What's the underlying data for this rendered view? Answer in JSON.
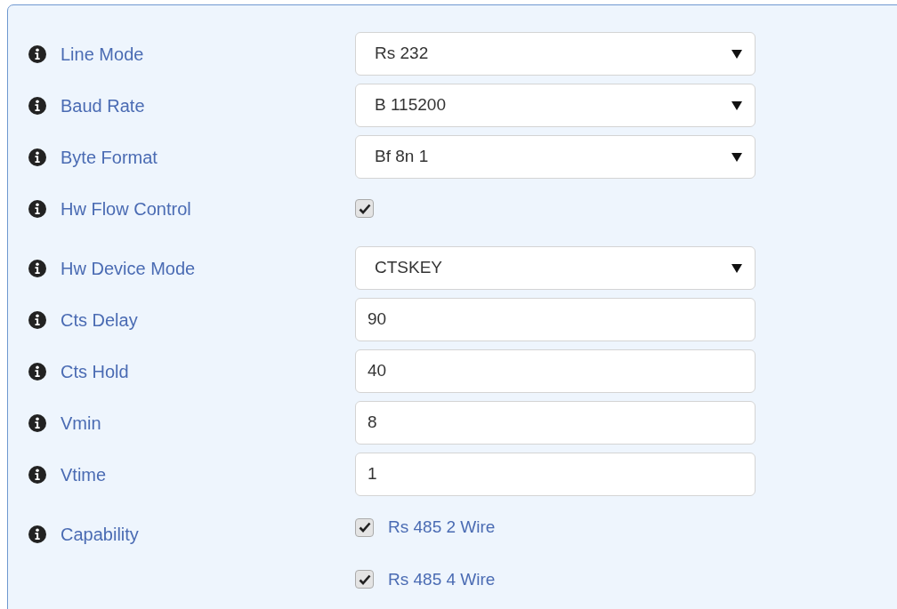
{
  "fields": [
    {
      "kind": "select",
      "label": "Line Mode",
      "value": "Rs 232"
    },
    {
      "kind": "select",
      "label": "Baud Rate",
      "value": "B 115200"
    },
    {
      "kind": "select",
      "label": "Byte Format",
      "value": "Bf 8n 1"
    },
    {
      "kind": "checkbox",
      "label": "Hw Flow Control",
      "checked": true
    },
    {
      "kind": "select",
      "label": "Hw Device Mode",
      "value": "CTSKEY"
    },
    {
      "kind": "text",
      "label": "Cts Delay",
      "value": "90"
    },
    {
      "kind": "text",
      "label": "Cts Hold",
      "value": "40"
    },
    {
      "kind": "text",
      "label": "Vmin",
      "value": "8"
    },
    {
      "kind": "text",
      "label": "Vtime",
      "value": "1"
    },
    {
      "kind": "options",
      "label": "Capability",
      "options": [
        {
          "label": "Rs 485 2 Wire",
          "checked": true
        },
        {
          "label": "Rs 485 4 Wire",
          "checked": true
        }
      ]
    }
  ]
}
